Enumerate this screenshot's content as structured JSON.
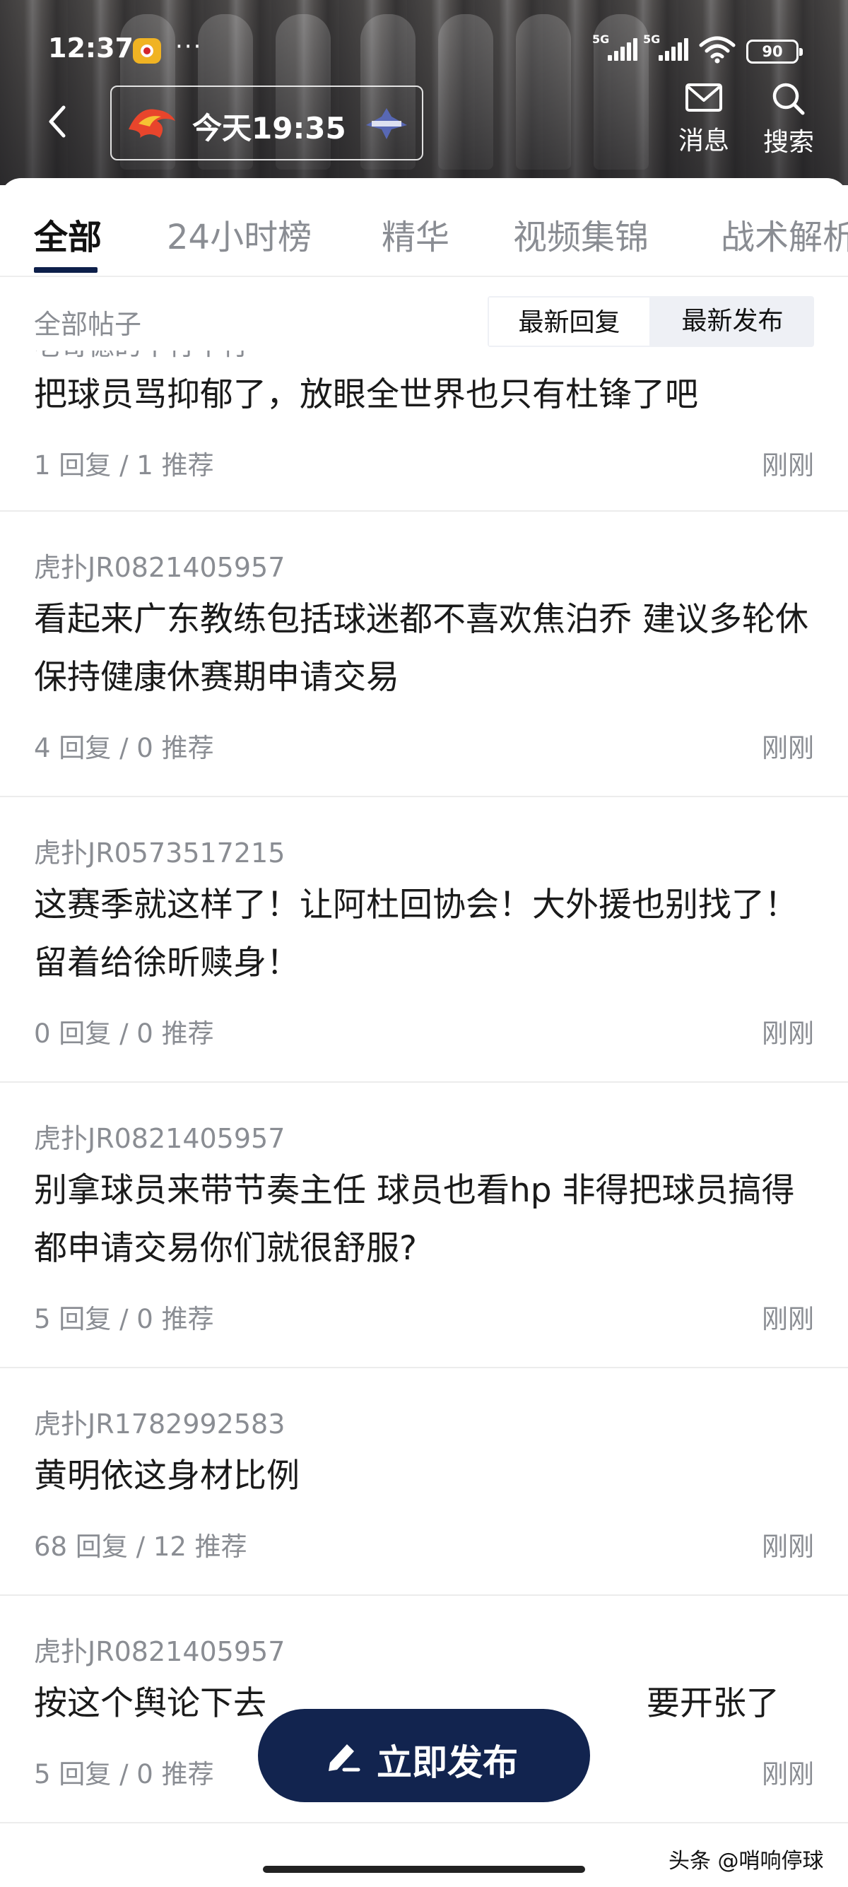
{
  "status_bar": {
    "time": "12:37",
    "more": "···",
    "network_1": "5G",
    "network_2": "5G",
    "battery": "90"
  },
  "header": {
    "match_time": "今天19:35",
    "actions": [
      {
        "label": "消息",
        "icon": "mail-icon"
      },
      {
        "label": "搜索",
        "icon": "search-icon"
      }
    ]
  },
  "tabs": [
    {
      "label": "全部",
      "active": true
    },
    {
      "label": "24小时榜",
      "active": false
    },
    {
      "label": "精华",
      "active": false
    },
    {
      "label": "视频集锦",
      "active": false
    },
    {
      "label": "战术解析",
      "active": false
    }
  ],
  "filter": {
    "title": "全部帖子",
    "options": [
      "最新回复",
      "最新发布"
    ],
    "selected": "最新发布"
  },
  "posts": [
    {
      "author": "老哥德的不行不行",
      "title": "把球员骂抑郁了，放眼全世界也只有杜锋了吧",
      "meta": "1 回复 / 1 推荐",
      "time": "刚刚"
    },
    {
      "author": "虎扑JR0821405957",
      "title": "看起来广东教练包括球迷都不喜欢焦泊乔 建议多轮休保持健康休赛期申请交易",
      "meta": "4 回复 / 0 推荐",
      "time": "刚刚"
    },
    {
      "author": "虎扑JR0573517215",
      "title": "这赛季就这样了！让阿杜回协会！大外援也别找了！留着给徐昕赎身！",
      "meta": "0 回复 / 0 推荐",
      "time": "刚刚"
    },
    {
      "author": "虎扑JR0821405957",
      "title": "别拿球员来带节奏主任  球员也看hp  非得把球员搞得都申请交易你们就很舒服?",
      "meta": "5 回复 / 0 推荐",
      "time": "刚刚"
    },
    {
      "author": "虎扑JR1782992583",
      "title": "黄明依这身材比例",
      "meta": "68 回复 / 12 推荐",
      "time": "刚刚"
    },
    {
      "author": "虎扑JR0821405957",
      "title": "按这个舆论下去                                    要开张了",
      "meta": "5 回复 / 0 推荐",
      "time": "刚刚"
    }
  ],
  "publish_button": {
    "label": "立即发布"
  },
  "watermark": "头条 @哨响停球",
  "colors": {
    "brand_navy": "#12244f",
    "tab_indicator": "#0d1f4a",
    "muted_text": "#8a8d93"
  }
}
